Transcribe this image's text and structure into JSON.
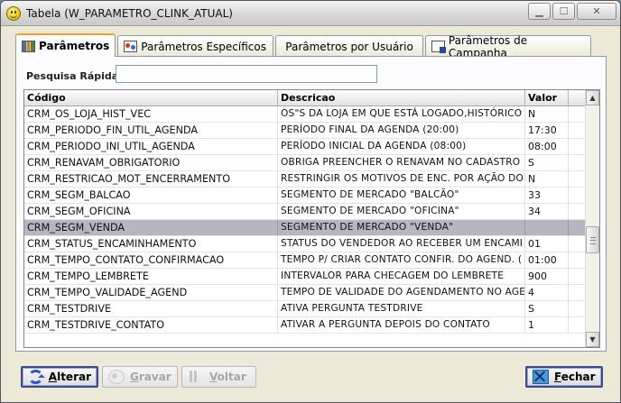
{
  "window": {
    "title": "Tabela (W_PARAMETRO_CLINK_ATUAL)",
    "controls": {
      "minimize": "▁",
      "maximize": "☐",
      "close": "✕"
    }
  },
  "tabs": [
    {
      "label": "Parâmetros",
      "active": true
    },
    {
      "label": "Parâmetros Específicos",
      "active": false
    },
    {
      "label": "Parâmetros por Usuário",
      "active": false
    },
    {
      "label": "Parâmetros de Campanha",
      "active": false
    }
  ],
  "search": {
    "label": "Pesquisa Rápida",
    "value": ""
  },
  "grid": {
    "columns": [
      "Código",
      "Descricao",
      "Valor"
    ],
    "rows": [
      {
        "code": "CRM_OS_LOJA_HIST_VEC",
        "desc": "OS\"S DA LOJA EM QUE ESTÁ LOGADO,HISTÓRICO",
        "val": "N"
      },
      {
        "code": "CRM_PERIODO_FIN_UTIL_AGENDA",
        "desc": "PERÍODO FINAL DA AGENDA (20:00)",
        "val": "17:30"
      },
      {
        "code": "CRM_PERIODO_INI_UTIL_AGENDA",
        "desc": "PERÍODO INICIAL DA AGENDA (08:00)",
        "val": "08:00"
      },
      {
        "code": "CRM_RENAVAM_OBRIGATORIO",
        "desc": "OBRIGA PREENCHER O RENAVAM NO CADASTRO",
        "val": "S"
      },
      {
        "code": "CRM_RESTRICAO_MOT_ENCERRAMENTO",
        "desc": "RESTRINGIR OS MOTIVOS DE ENC. POR AÇÃO DO",
        "val": "N"
      },
      {
        "code": "CRM_SEGM_BALCAO",
        "desc": "SEGMENTO DE MERCADO \"BALCÃO\"",
        "val": "33"
      },
      {
        "code": "CRM_SEGM_OFICINA",
        "desc": "SEGMENTO DE MERCADO \"OFICINA\"",
        "val": "34"
      },
      {
        "code": "CRM_SEGM_VENDA",
        "desc": "SEGMENTO DE MERCADO \"VENDA\"",
        "val": "",
        "selected": true
      },
      {
        "code": "CRM_STATUS_ENCAMINHAMENTO",
        "desc": "STATUS DO VENDEDOR AO RECEBER UM ENCAMI",
        "val": "01"
      },
      {
        "code": "CRM_TEMPO_CONTATO_CONFIRMACAO",
        "desc": "TEMPO P/ CRIAR CONTATO CONFIR. DO AGEND. (",
        "val": "01:00"
      },
      {
        "code": "CRM_TEMPO_LEMBRETE",
        "desc": "INTERVALOR PARA CHECAGEM DO LEMBRETE",
        "val": "900"
      },
      {
        "code": "CRM_TEMPO_VALIDADE_AGEND",
        "desc": "TEMPO DE VALIDADE DO AGENDAMENTO NO AGE",
        "val": "4"
      },
      {
        "code": "CRM_TESTDRIVE",
        "desc": "ATIVA PERGUNTA TESTDRIVE",
        "val": "S"
      },
      {
        "code": "CRM_TESTDRIVE_CONTATO",
        "desc": "ATIVAR A PERGUNTA DEPOIS DO CONTATO",
        "val": "1"
      }
    ]
  },
  "buttons": {
    "alterar": "Alterar",
    "gravar": "Gravar",
    "voltar": "Voltar",
    "fechar": "Fechar"
  },
  "colors": {
    "selected_row": "#b6b6c0",
    "tab_accent": "#f0a030"
  }
}
